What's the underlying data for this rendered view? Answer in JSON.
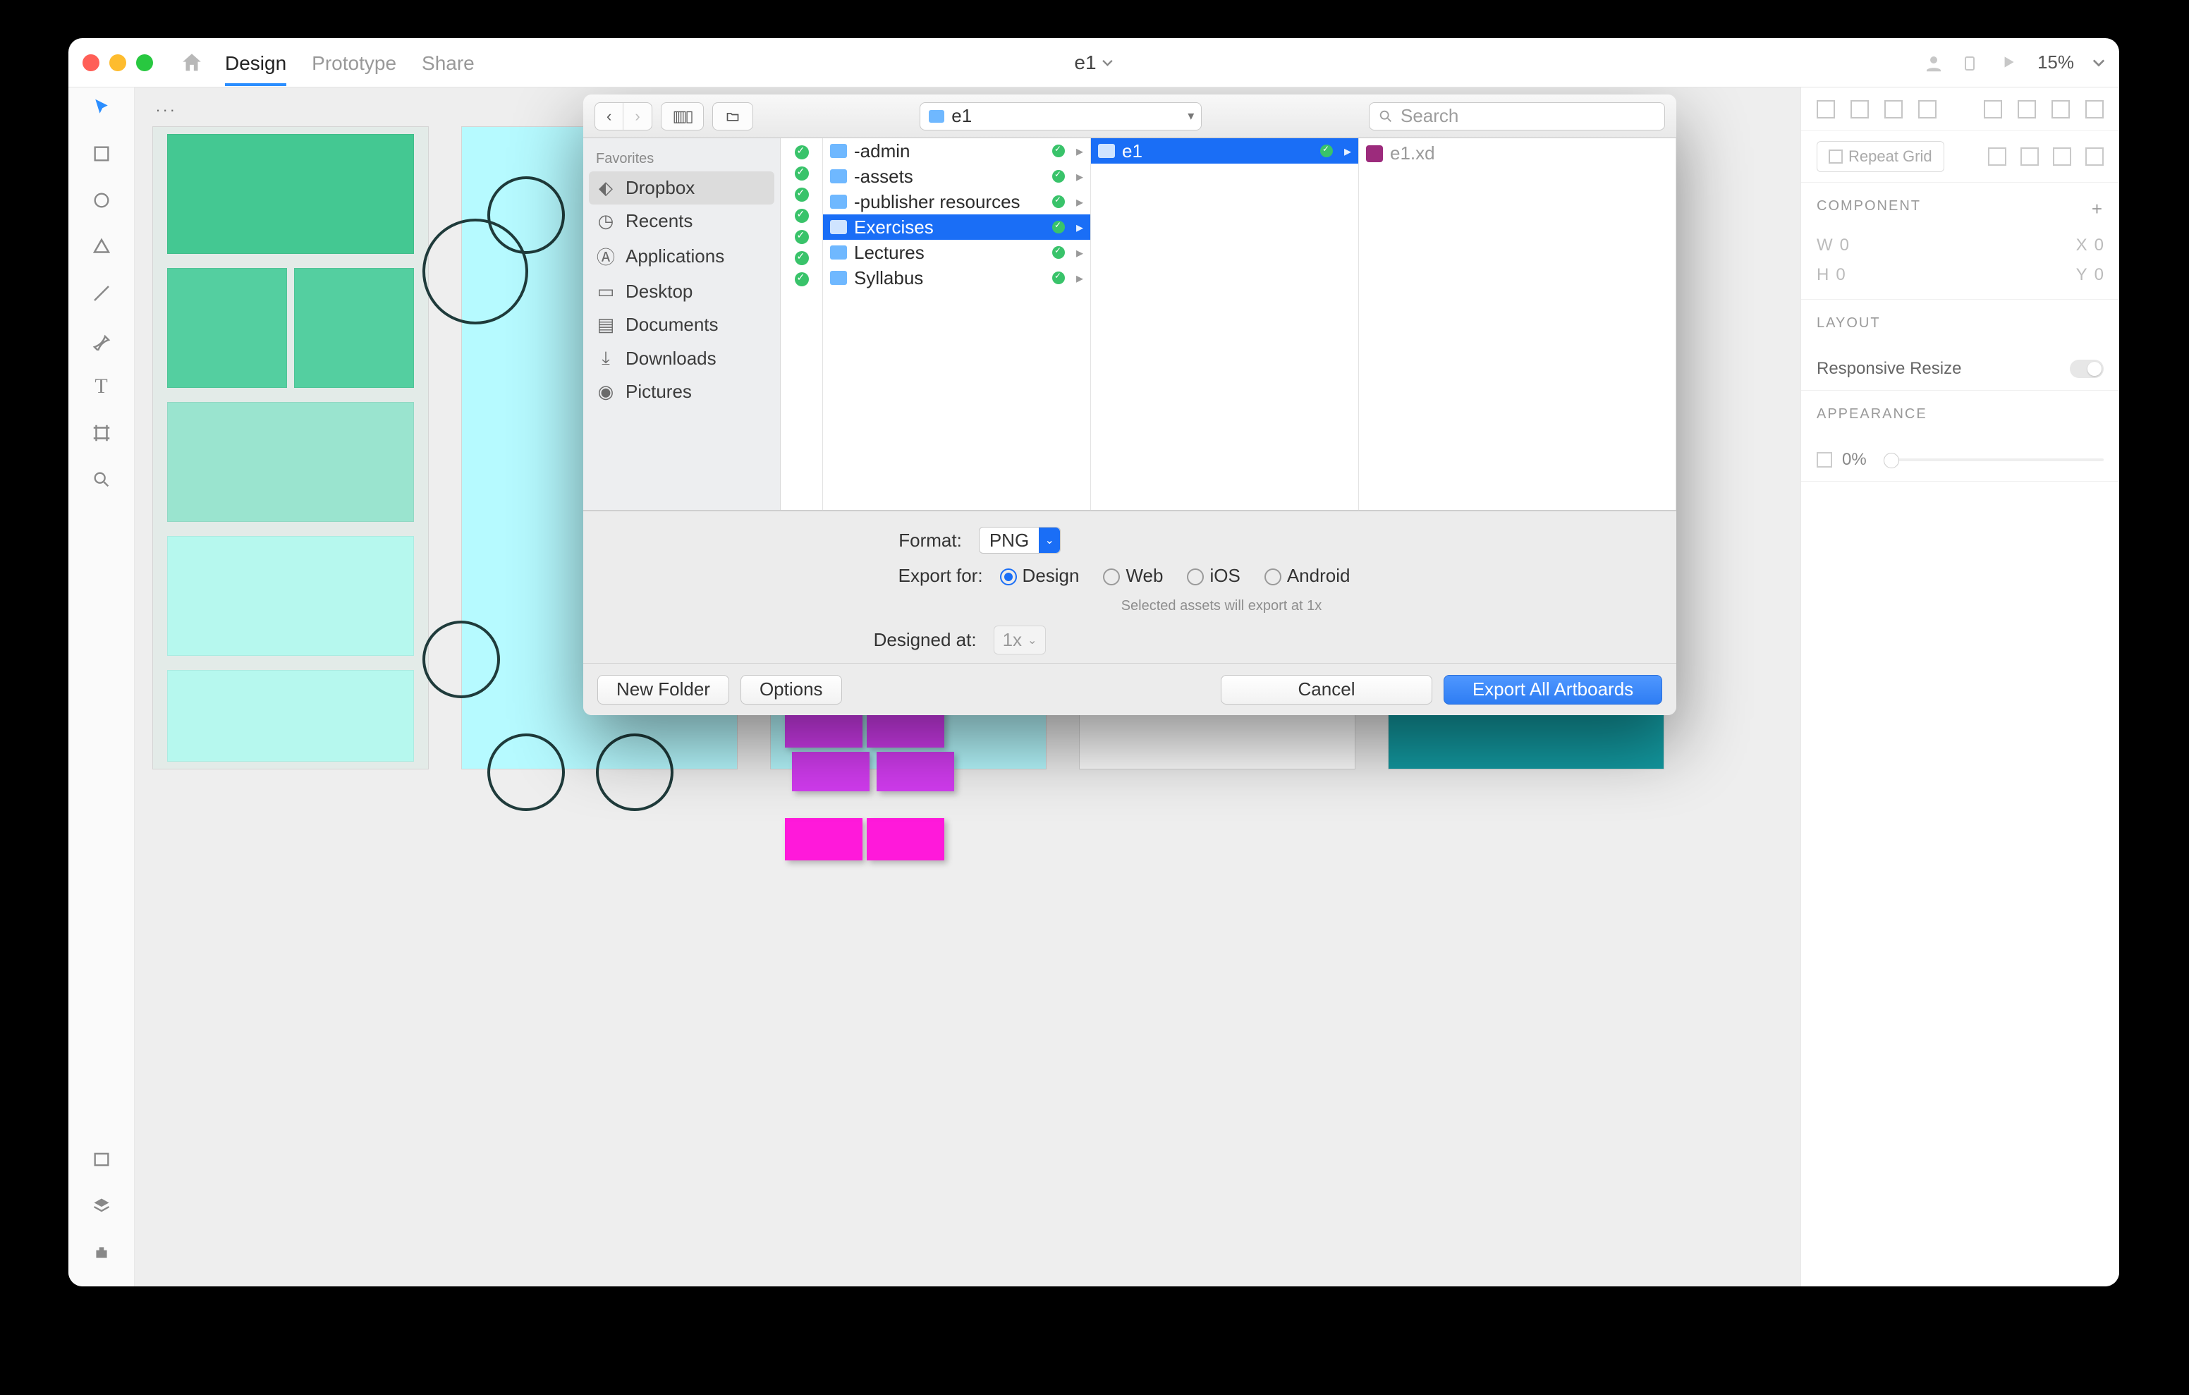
{
  "titlebar": {
    "tabs": {
      "design": "Design",
      "prototype": "Prototype",
      "share": "Share"
    },
    "doc_name": "e1",
    "zoom": "15%"
  },
  "canvas": {
    "label": "..."
  },
  "rightpanel": {
    "repeat_grid": "Repeat Grid",
    "component": "COMPONENT",
    "w": "W",
    "w_val": "0",
    "x": "X",
    "x_val": "0",
    "h": "H",
    "h_val": "0",
    "y": "Y",
    "y_val": "0",
    "layout": "LAYOUT",
    "responsive": "Responsive Resize",
    "appearance": "APPEARANCE",
    "opacity": "0%"
  },
  "modal": {
    "path_folder": "e1",
    "search_placeholder": "Search",
    "favorites_header": "Favorites",
    "favorites": [
      "Dropbox",
      "Recents",
      "Applications",
      "Desktop",
      "Documents",
      "Downloads",
      "Pictures"
    ],
    "col1": [
      "-admin",
      "-assets",
      "-publisher resources",
      "Exercises",
      "Lectures",
      "Syllabus"
    ],
    "col1_selected": "Exercises",
    "col2": [
      "e1"
    ],
    "col2_selected": "e1",
    "col3_file": "e1.xd",
    "format_label": "Format:",
    "format_value": "PNG",
    "exportfor_label": "Export for:",
    "exportfor_options": [
      "Design",
      "Web",
      "iOS",
      "Android"
    ],
    "exportfor_selected": "Design",
    "hint": "Selected assets will export at 1x",
    "designedat_label": "Designed at:",
    "designedat_value": "1x",
    "new_folder": "New Folder",
    "options": "Options",
    "cancel": "Cancel",
    "export": "Export All Artboards"
  }
}
